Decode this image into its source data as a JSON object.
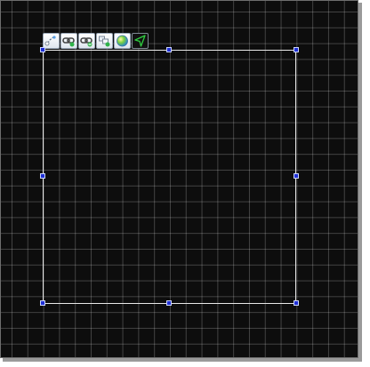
{
  "toolbar": {
    "tools": [
      {
        "icon": "connector-icon"
      },
      {
        "icon": "link-add-icon"
      },
      {
        "icon": "link-remove-icon"
      },
      {
        "icon": "shape-add-icon"
      },
      {
        "icon": "color-ball-icon"
      },
      {
        "icon": "arrow-pointer-icon"
      }
    ]
  },
  "colors": {
    "canvas_background": "#0d0d0d",
    "grid_line": "#5a5a5a",
    "selection_border": "#e8e8e8",
    "handle_fill": "#1f2fd6",
    "pointer_green": "#2ecc40"
  }
}
